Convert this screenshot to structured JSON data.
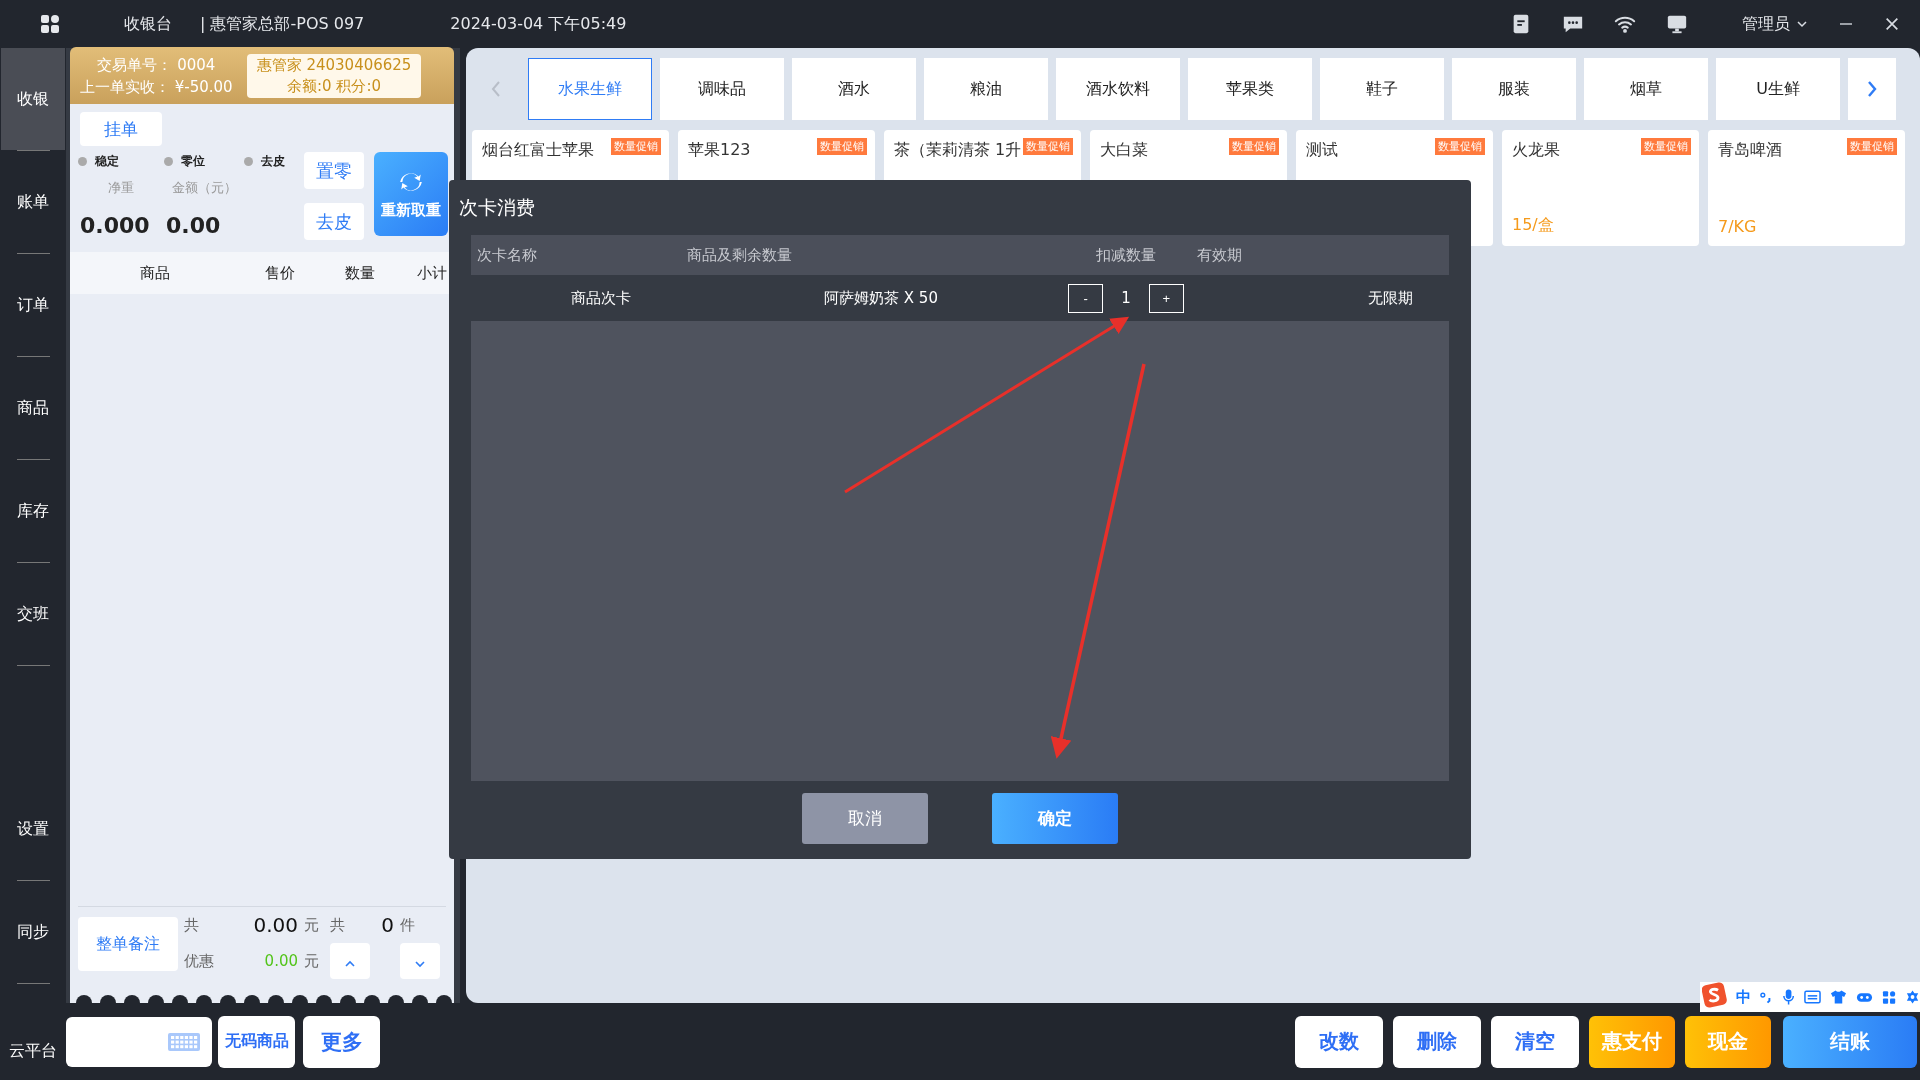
{
  "top_bar": {
    "title": "收银台",
    "store": "| 惠管家总部-POS 097",
    "datetime": "2024-03-04 下午05:49",
    "user": "管理员"
  },
  "sidebar": {
    "items": [
      {
        "label": "收银",
        "selected": true
      },
      {
        "label": "账单",
        "selected": false
      },
      {
        "label": "订单",
        "selected": false
      },
      {
        "label": "商品",
        "selected": false
      },
      {
        "label": "库存",
        "selected": false
      },
      {
        "label": "交班",
        "selected": false
      },
      {
        "label": "设置",
        "selected": false
      },
      {
        "label": "同步",
        "selected": false
      }
    ],
    "bottom_label": "云平台"
  },
  "order": {
    "trade_no": "交易单号：  0004",
    "last_paid": "上一单实收：  ¥-50.00",
    "member": "惠管家  24030406625",
    "member_balance": "余额:0 积分:0"
  },
  "hold_button": "挂单",
  "scale": {
    "indicators": [
      "稳定",
      "零位",
      "去皮"
    ],
    "net_label": "净重",
    "net": "0.000",
    "amount_label": "金额（元）",
    "amount": "0.00",
    "buttons": [
      "置零",
      "去皮"
    ],
    "reweigh": "重新取重"
  },
  "cart": {
    "columns": [
      "商品",
      "售价",
      "数量",
      "小计"
    ]
  },
  "summary": {
    "note_button": "整单备注",
    "total_label": "共",
    "total": "0.00",
    "total_unit": "元",
    "count_label": "共",
    "count": "0",
    "count_unit": "件",
    "discount_label": "优惠",
    "discount": "0.00",
    "discount_unit": "元"
  },
  "categories": [
    {
      "label": "水果生鲜",
      "selected": true
    },
    {
      "label": "调味品",
      "selected": false
    },
    {
      "label": "酒水",
      "selected": false
    },
    {
      "label": "粮油",
      "selected": false
    },
    {
      "label": "酒水饮料",
      "selected": false
    },
    {
      "label": "苹果类",
      "selected": false
    },
    {
      "label": "鞋子",
      "selected": false
    },
    {
      "label": "服装",
      "selected": false
    },
    {
      "label": "烟草",
      "selected": false
    },
    {
      "label": "U生鲜",
      "selected": false
    }
  ],
  "products": [
    {
      "name": "烟台红富士苹果",
      "badge": "数量促销"
    },
    {
      "name": "苹果123",
      "badge": "数量促销"
    },
    {
      "name": "茶（茉莉清茶  1升",
      "badge": "数量促销"
    },
    {
      "name": "大白菜",
      "badge": "数量促销"
    },
    {
      "name": "测试",
      "badge": "数量促销"
    },
    {
      "name": "火龙果",
      "badge": "数量促销",
      "price": "15/盒"
    },
    {
      "name": "青岛啤酒",
      "badge": "数量促销",
      "price": "7/KG"
    }
  ],
  "bottom_left_buttons": [
    "无码商品",
    "更多"
  ],
  "actions": [
    {
      "label": "改数",
      "kind": "plain"
    },
    {
      "label": "删除",
      "kind": "plain"
    },
    {
      "label": "清空",
      "kind": "plain"
    },
    {
      "label": "惠支付",
      "kind": "orange"
    },
    {
      "label": "现金",
      "kind": "orange"
    },
    {
      "label": "结账",
      "kind": "blue"
    }
  ],
  "ime": {
    "mode": "中"
  },
  "dialog": {
    "title": "次卡消费",
    "columns": [
      "次卡名称",
      "商品及剩余数量",
      "扣减数量",
      "有效期"
    ],
    "rows": [
      {
        "card": "商品次卡",
        "item": "阿萨姆奶茶 X 50",
        "minus": "-",
        "quantity": "1",
        "plus": "+",
        "validity": "无限期"
      }
    ],
    "buttons": [
      {
        "label": "取消",
        "kind": "secondary"
      },
      {
        "label": "确定",
        "kind": "primary"
      }
    ]
  }
}
